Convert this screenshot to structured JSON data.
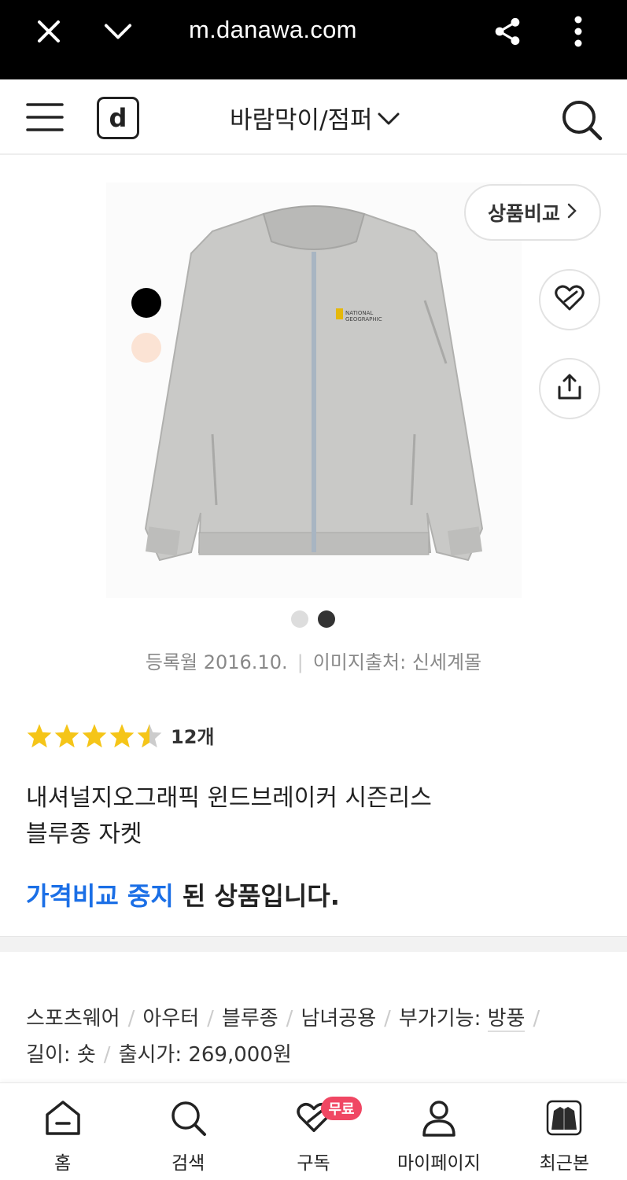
{
  "browser": {
    "url": "m.danawa.com"
  },
  "header": {
    "logo_text": "d",
    "category": "바람막이/점퍼"
  },
  "product": {
    "compare_label": "상품비교",
    "swatches": [
      "#000000",
      "#fbe3d4"
    ],
    "image_dots": [
      "#dddddd",
      "#333333"
    ],
    "reg_date": "등록월 2016.10.",
    "image_source": "이미지출처: 신세계몰",
    "rating_value": 4.5,
    "review_count": "12개",
    "title_line1": "내셔널지오그래픽 윈드브레이커 시즌리스",
    "title_line2": "블루종 자켓",
    "status_highlight": "가격비교 중지",
    "status_rest": " 된 상품입니다."
  },
  "specs": {
    "items": [
      "스포츠웨어",
      "아우터",
      "블루종",
      "남녀공용"
    ],
    "feature_label": "부가기능: ",
    "feature_value": "방풍",
    "length": "길이: 숏",
    "release_price": "출시가: 269,000원"
  },
  "bottom_nav": {
    "home": "홈",
    "search": "검색",
    "subscribe": "구독",
    "subscribe_badge": "무료",
    "mypage": "마이페이지",
    "recent": "최근본"
  },
  "colors": {
    "accent_blue": "#1b6fe6",
    "star": "#f5c518",
    "badge": "#f04763"
  }
}
